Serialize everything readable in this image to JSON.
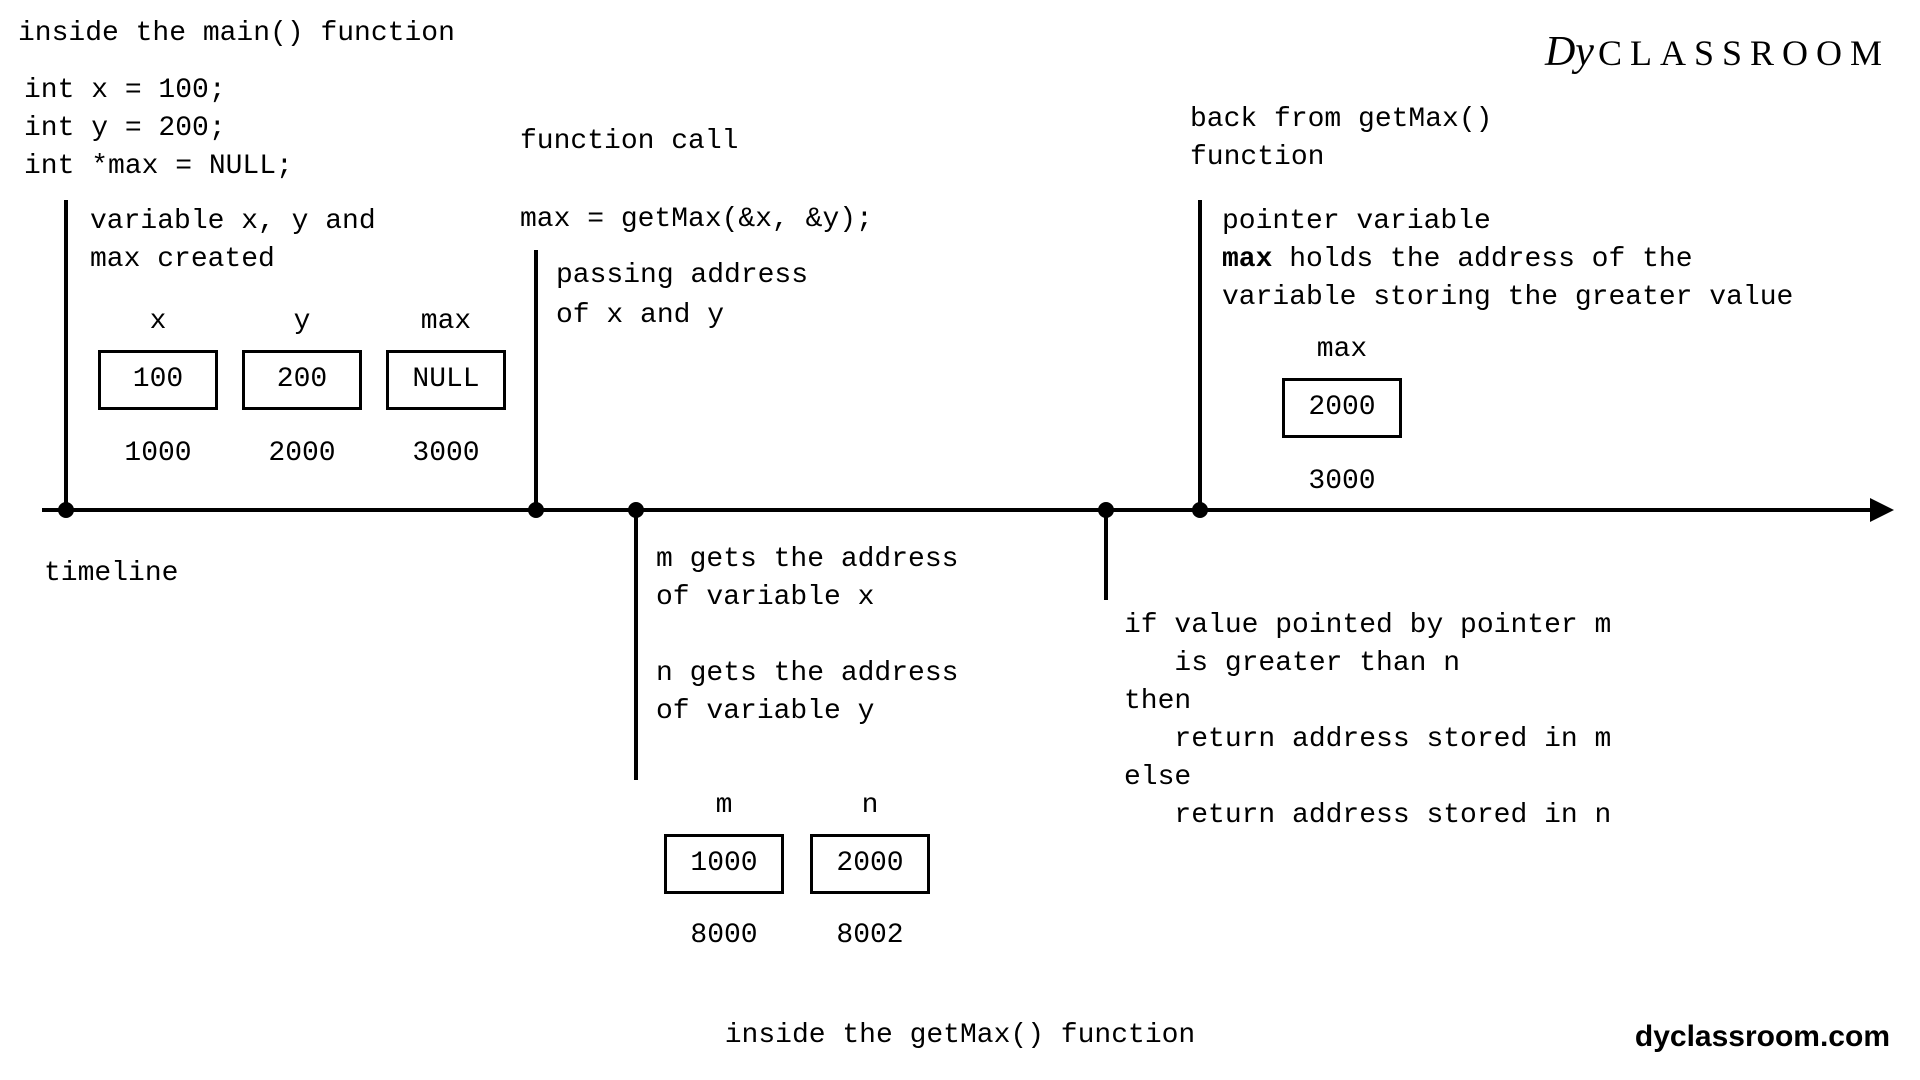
{
  "header": {
    "main_label": "inside the main() function",
    "code_line1": "int x = 100;",
    "code_line2": "int y = 200;",
    "code_line3": "int *max = NULL;"
  },
  "logo": {
    "script": "Dy",
    "text": "CLASSROOM",
    "site": "dyclassroom.com"
  },
  "timeline_label": "timeline",
  "block1": {
    "caption1": "variable x, y and",
    "caption2": "max created",
    "vars": {
      "x": {
        "name": "x",
        "value": "100",
        "addr": "1000"
      },
      "y": {
        "name": "y",
        "value": "200",
        "addr": "2000"
      },
      "max": {
        "name": "max",
        "value": "NULL",
        "addr": "3000"
      }
    }
  },
  "block2": {
    "title": "function call",
    "call": "max = getMax(&x, &y);",
    "caption1": "passing address",
    "caption2": "of x and y"
  },
  "block3": {
    "caption1": "m gets the address",
    "caption2": "of variable x",
    "caption3": "n gets the address",
    "caption4": "of variable y",
    "vars": {
      "m": {
        "name": "m",
        "value": "1000",
        "addr": "8000"
      },
      "n": {
        "name": "n",
        "value": "2000",
        "addr": "8002"
      }
    }
  },
  "block4": {
    "line1": "if value pointed by pointer m",
    "line2": "   is greater than n",
    "line3": "then",
    "line4": "   return address stored in m",
    "line5": "else",
    "line6": "   return address stored in n"
  },
  "block5": {
    "title1": "back from getMax()",
    "title2": "function",
    "caption1": "pointer variable",
    "caption2a": "max",
    "caption2b": " holds the address of the",
    "caption3": "variable storing the greater value",
    "var": {
      "name": "max",
      "value": "2000",
      "addr": "3000"
    }
  },
  "footer_label": "inside the getMax() function"
}
